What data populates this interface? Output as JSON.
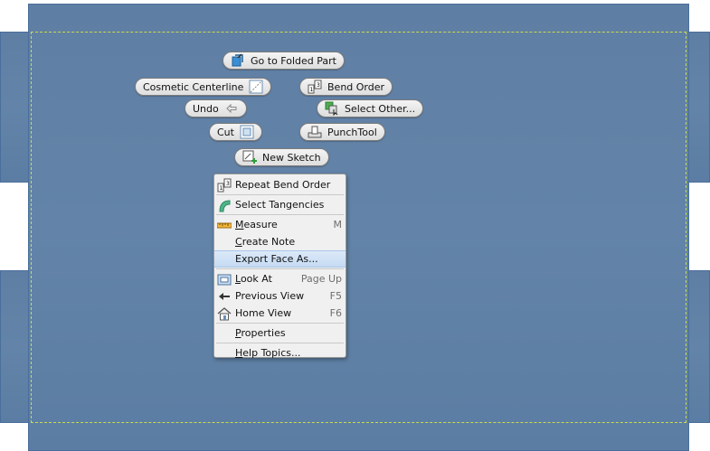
{
  "marking_menu": {
    "go_to_folded_part": "Go to Folded Part",
    "cosmetic_centerline": "Cosmetic Centerline",
    "bend_order": "Bend Order",
    "undo": "Undo",
    "select_other": "Select Other...",
    "cut": "Cut",
    "punch_tool": "PunchTool",
    "new_sketch": "New Sketch"
  },
  "context_menu": {
    "items": [
      {
        "label": "Repeat Bend Order",
        "shortcut": "",
        "icon": "bend-order-icon"
      },
      {
        "label": "Select Tangencies",
        "shortcut": "",
        "icon": "tangencies-icon"
      },
      {
        "label": "Measure",
        "shortcut": "M",
        "icon": "ruler-icon"
      },
      {
        "label": "Create Note",
        "shortcut": "",
        "icon": ""
      },
      {
        "label": "Export Face As...",
        "shortcut": "",
        "icon": "",
        "highlighted": true
      },
      {
        "label": "Look At",
        "shortcut": "Page Up",
        "icon": "look-at-icon"
      },
      {
        "label": "Previous View",
        "shortcut": "F5",
        "icon": "previous-view-icon"
      },
      {
        "label": "Home View",
        "shortcut": "F6",
        "icon": "home-icon"
      },
      {
        "label": "Properties",
        "shortcut": "",
        "icon": ""
      },
      {
        "label": "Help Topics...",
        "shortcut": "",
        "icon": ""
      }
    ]
  },
  "colors": {
    "sheet": "#6384a8",
    "bend_line": "#c8dc4a",
    "highlight": "#c5dbf3"
  }
}
